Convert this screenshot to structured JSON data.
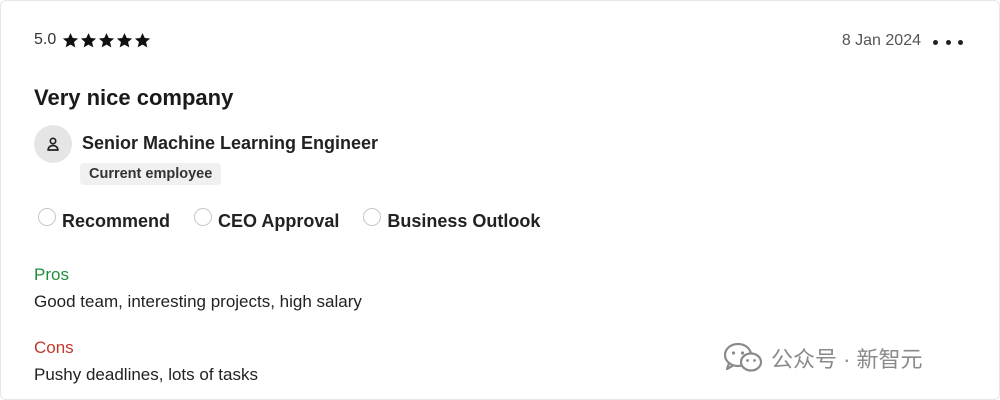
{
  "review": {
    "rating": "5.0",
    "stars": 5,
    "date": "8 Jan 2024",
    "title": "Very nice company",
    "job_title": "Senior Machine Learning Engineer",
    "employment_status": "Current employee",
    "indicators": [
      {
        "label": "Recommend",
        "icon": "empty-circle-icon"
      },
      {
        "label": "CEO Approval",
        "icon": "empty-circle-icon"
      },
      {
        "label": "Business Outlook",
        "icon": "empty-circle-icon"
      }
    ],
    "pros_label": "Pros",
    "pros_text": "Good team, interesting projects, high salary",
    "cons_label": "Cons",
    "cons_text": "Pushy deadlines, lots of tasks"
  },
  "watermark": {
    "text": "公众号 · 新智元",
    "icon": "wechat-icon"
  },
  "colors": {
    "pros": "#1f8f3a",
    "cons": "#c0392b",
    "star": "#111111"
  }
}
